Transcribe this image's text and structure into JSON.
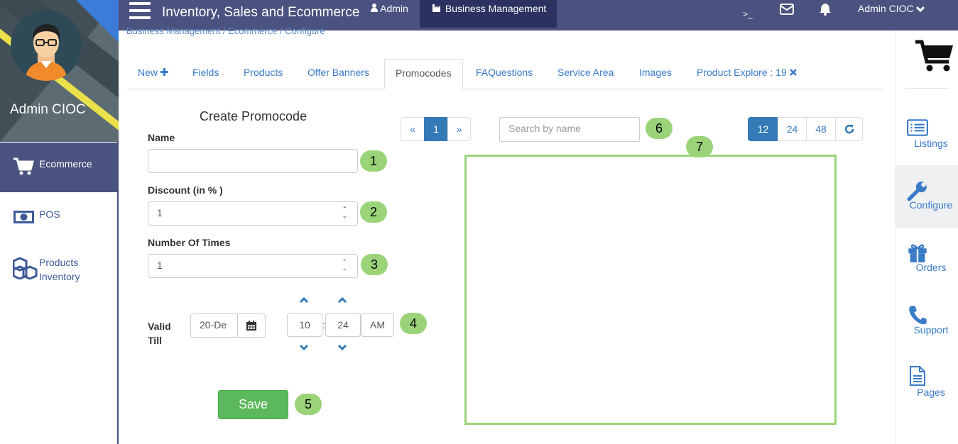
{
  "app": {
    "title": "Inventory, Sales and Ecommerce"
  },
  "topbar": {
    "admin_label": "Admin",
    "business_label": "Business Management",
    "terminal_icon": ">_",
    "user_label": "Admin CIOC"
  },
  "profile": {
    "name": "Admin CIOC"
  },
  "sidebar": {
    "items": [
      {
        "label": "Ecommerce",
        "icon": "cart-icon",
        "active": true
      },
      {
        "label": "POS",
        "icon": "money-icon",
        "active": false
      },
      {
        "label": "Products",
        "label2": "Inventory",
        "icon": "cubes-icon",
        "active": false
      }
    ]
  },
  "breadcrumb": {
    "text": "Business Management / Ecommerce / Configure"
  },
  "tabs": [
    {
      "label": "New"
    },
    {
      "label": "Fields"
    },
    {
      "label": "Products"
    },
    {
      "label": "Offer Banners"
    },
    {
      "label": "Promocodes"
    },
    {
      "label": "FAQuestions"
    },
    {
      "label": "Service Area"
    },
    {
      "label": "Images"
    },
    {
      "label": "Product Explore : 19"
    }
  ],
  "form": {
    "title": "Create Promocode",
    "name_label": "Name",
    "name_value": "",
    "discount_label": "Discount (in % )",
    "discount_value": "1",
    "times_label": "Number Of Times",
    "times_value": "1",
    "valid_label_1": "Valid",
    "valid_label_2": "Till",
    "date_value": "20-De",
    "hour_value": "10",
    "minute_value": "24",
    "meridian_value": "AM",
    "save_label": "Save"
  },
  "pager": {
    "prev": "«",
    "current": "1",
    "next": "»"
  },
  "search": {
    "placeholder": "Search by name"
  },
  "page_size": {
    "options": [
      "12",
      "24",
      "48"
    ],
    "selected": "12"
  },
  "badges": [
    "1",
    "2",
    "3",
    "4",
    "5",
    "6",
    "7"
  ],
  "right_sidebar": {
    "items": [
      {
        "label": "Listings"
      },
      {
        "label": "Configure",
        "active": true
      },
      {
        "label": "Orders"
      },
      {
        "label": "Support"
      },
      {
        "label": "Pages"
      }
    ]
  },
  "colors": {
    "nav": "#4a5280",
    "nav_dark": "#2b3160",
    "primary": "#337ab7",
    "success": "#5cb85c",
    "badge": "#9bd379"
  }
}
